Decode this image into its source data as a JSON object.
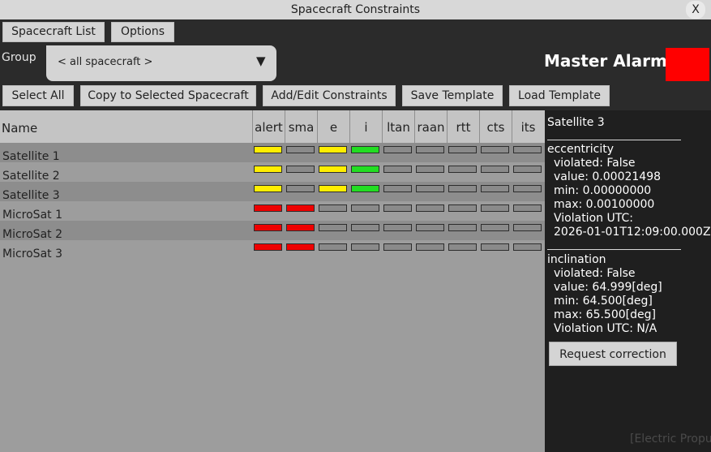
{
  "window": {
    "title": "Spacecraft Constraints",
    "close_label": "X"
  },
  "top_buttons": {
    "spacecraft_list": "Spacecraft List",
    "options": "Options"
  },
  "group": {
    "label": "Group",
    "value": "< all spacecraft >",
    "arrow": "▼"
  },
  "master_alarm": {
    "label": "Master Alarm",
    "color": "#ff0000"
  },
  "actions": {
    "select_all": "Select All",
    "copy": "Copy to Selected Spacecraft",
    "add_edit": "Add/Edit Constraints",
    "save": "Save Template",
    "load": "Load Template"
  },
  "table": {
    "name_header": "Name",
    "columns": [
      "alert",
      "sma",
      "e",
      "i",
      "ltan",
      "raan",
      "rtt",
      "cts",
      "its"
    ],
    "rows": [
      {
        "name": "Satellite 1",
        "status": [
          "yellow",
          "gray",
          "yellow",
          "green",
          "gray",
          "gray",
          "gray",
          "gray",
          "gray"
        ]
      },
      {
        "name": "Satellite 2",
        "status": [
          "yellow",
          "gray",
          "yellow",
          "green",
          "gray",
          "gray",
          "gray",
          "gray",
          "gray"
        ]
      },
      {
        "name": "Satellite 3",
        "status": [
          "yellow",
          "gray",
          "yellow",
          "green",
          "gray",
          "gray",
          "gray",
          "gray",
          "gray"
        ]
      },
      {
        "name": "MicroSat 1",
        "status": [
          "red",
          "red",
          "gray",
          "gray",
          "gray",
          "gray",
          "gray",
          "gray",
          "gray"
        ]
      },
      {
        "name": "MicroSat 2",
        "status": [
          "red",
          "red",
          "gray",
          "gray",
          "gray",
          "gray",
          "gray",
          "gray",
          "gray"
        ]
      },
      {
        "name": "MicroSat 3",
        "status": [
          "red",
          "red",
          "gray",
          "gray",
          "gray",
          "gray",
          "gray",
          "gray",
          "gray"
        ]
      }
    ]
  },
  "status_colors": {
    "yellow": "#ffee00",
    "green": "#22dd22",
    "red": "#ee0000",
    "gray": "#8a8a8a"
  },
  "detail": {
    "title": "Satellite 3",
    "eccentricity": {
      "heading": "eccentricity",
      "violated": "violated: False",
      "value": "value: 0.00021498",
      "min": "min: 0.00000000",
      "max": "max: 0.00100000",
      "violation_label": "Violation UTC:",
      "violation_time": "2026-01-01T12:09:00.000Z"
    },
    "inclination": {
      "heading": "inclination",
      "violated": "violated: False",
      "value": "value: 64.999[deg]",
      "min": "min: 64.500[deg]",
      "max": "max: 65.500[deg]",
      "violation": "Violation UTC: N/A"
    },
    "request_button": "Request correction",
    "watermark": "[Electric Propu"
  }
}
